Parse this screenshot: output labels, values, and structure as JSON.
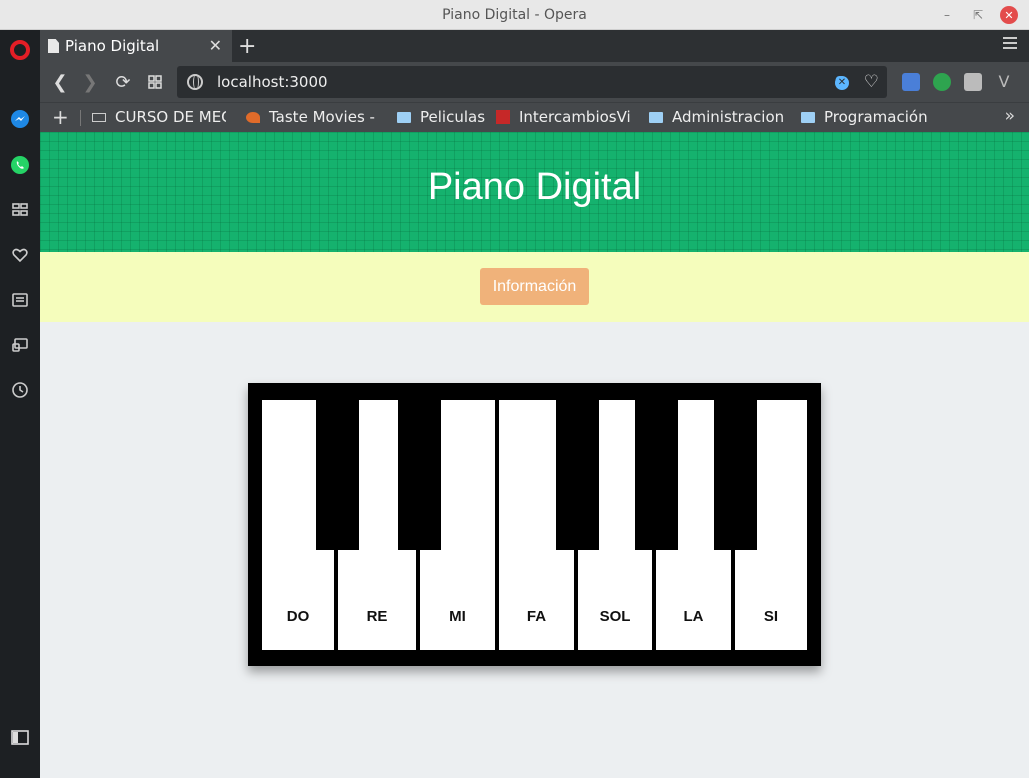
{
  "window": {
    "title": "Piano Digital - Opera"
  },
  "tabs": [
    {
      "label": "Piano Digital"
    }
  ],
  "address_bar": {
    "url": "localhost:3000",
    "ad_block_count": "0"
  },
  "bookmarks": [
    {
      "label": "CURSO DE MEC",
      "icon": "keyboard-icon"
    },
    {
      "label": "Taste Movies - F",
      "icon": "taste-movies-icon"
    },
    {
      "label": "Peliculas",
      "icon": "folder-icon"
    },
    {
      "label": "IntercambiosVirt",
      "icon": "iv-icon"
    },
    {
      "label": "Administracion y",
      "icon": "folder-icon"
    },
    {
      "label": "Programación",
      "icon": "folder-icon"
    }
  ],
  "page": {
    "title": "Piano Digital",
    "info_button": "Información",
    "keys": [
      "DO",
      "RE",
      "MI",
      "FA",
      "SOL",
      "LA",
      "SI"
    ]
  },
  "colors": {
    "header_green": "#15b26e",
    "info_bar": "#f5fdbc",
    "info_button": "#f0b27a"
  }
}
